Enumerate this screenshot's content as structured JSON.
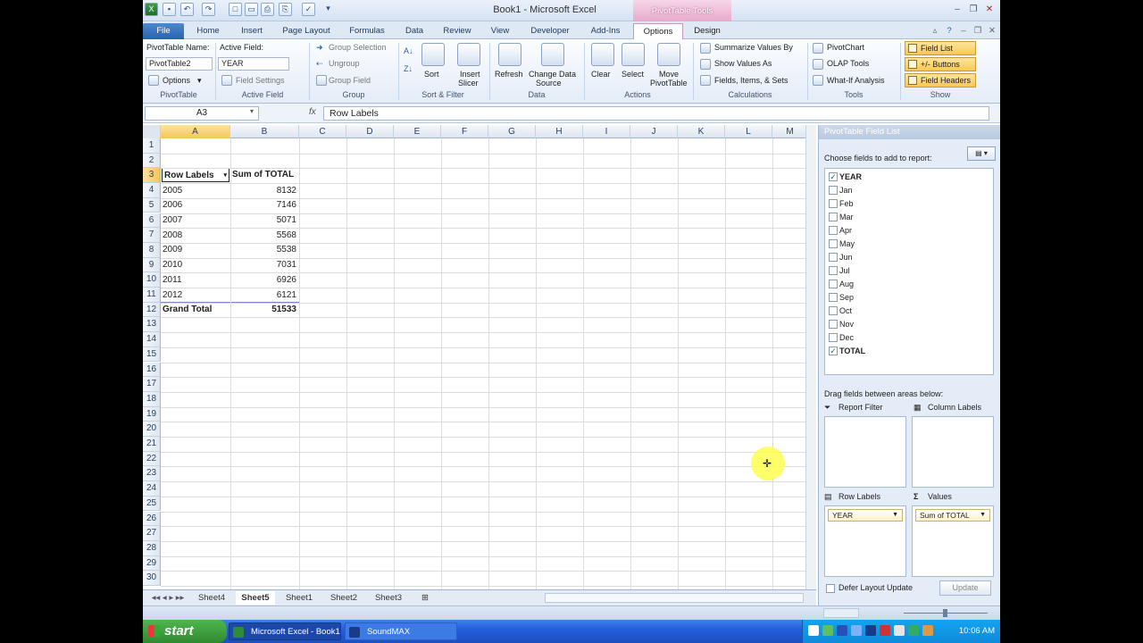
{
  "window": {
    "title": "Book1  -  Microsoft Excel",
    "context_tab_header": "PivotTable Tools"
  },
  "tabs": [
    "File",
    "Home",
    "Insert",
    "Page Layout",
    "Formulas",
    "Data",
    "Review",
    "View",
    "Developer",
    "Add-Ins",
    "Options",
    "Design"
  ],
  "ribbon": {
    "pivottable": {
      "name_label": "PivotTable Name:",
      "name_value": "PivotTable2",
      "options": "Options",
      "group": "PivotTable"
    },
    "active_field": {
      "label": "Active Field:",
      "value": "YEAR",
      "settings": "Field Settings",
      "group": "Active Field"
    },
    "group": {
      "selection": "Group Selection",
      "ungroup": "Ungroup",
      "field": "Group Field",
      "group": "Group"
    },
    "sort": {
      "sort": "Sort",
      "insert_slicer_1": "Insert",
      "insert_slicer_2": "Slicer",
      "group": "Sort & Filter"
    },
    "data": {
      "refresh": "Refresh",
      "change_1": "Change Data",
      "change_2": "Source",
      "group": "Data"
    },
    "actions": {
      "clear": "Clear",
      "select": "Select",
      "move_1": "Move",
      "move_2": "PivotTable",
      "group": "Actions"
    },
    "calculations": {
      "summarize": "Summarize Values By",
      "show_as": "Show Values As",
      "fields": "Fields, Items, & Sets",
      "group": "Calculations"
    },
    "tools": {
      "chart": "PivotChart",
      "olap": "OLAP Tools",
      "whatif": "What-If Analysis",
      "group": "Tools"
    },
    "show": {
      "field_list": "Field List",
      "buttons": "+/- Buttons",
      "headers": "Field Headers",
      "group": "Show"
    }
  },
  "formula_bar": {
    "name_box": "A3",
    "fx": "fx",
    "formula": "Row Labels"
  },
  "columns": [
    "A",
    "B",
    "C",
    "D",
    "E",
    "F",
    "G",
    "H",
    "I",
    "J",
    "K",
    "L",
    "M"
  ],
  "rows": [
    "1",
    "2",
    "3",
    "4",
    "5",
    "6",
    "7",
    "8",
    "9",
    "10",
    "11",
    "12",
    "13",
    "14",
    "15",
    "16",
    "17",
    "18",
    "19",
    "20",
    "21",
    "22",
    "23",
    "24",
    "25",
    "26",
    "27",
    "28",
    "29",
    "30"
  ],
  "pivot": {
    "header_a": "Row Labels",
    "header_b": "Sum of TOTAL",
    "rows": [
      {
        "label": "2005",
        "value": "8132"
      },
      {
        "label": "2006",
        "value": "7146"
      },
      {
        "label": "2007",
        "value": "5071"
      },
      {
        "label": "2008",
        "value": "5568"
      },
      {
        "label": "2009",
        "value": "5538"
      },
      {
        "label": "2010",
        "value": "7031"
      },
      {
        "label": "2011",
        "value": "6926"
      },
      {
        "label": "2012",
        "value": "6121"
      }
    ],
    "total_label": "Grand Total",
    "total_value": "51533"
  },
  "sheets": [
    "Sheet4",
    "Sheet5",
    "Sheet1",
    "Sheet2",
    "Sheet3"
  ],
  "field_list": {
    "title": "PivotTable Field List",
    "choose": "Choose fields to add to report:",
    "fields": [
      {
        "name": "YEAR",
        "checked": "✓"
      },
      {
        "name": "Jan",
        "checked": ""
      },
      {
        "name": "Feb",
        "checked": ""
      },
      {
        "name": "Mar",
        "checked": ""
      },
      {
        "name": "Apr",
        "checked": ""
      },
      {
        "name": "May",
        "checked": ""
      },
      {
        "name": "Jun",
        "checked": ""
      },
      {
        "name": "Jul",
        "checked": ""
      },
      {
        "name": "Aug",
        "checked": ""
      },
      {
        "name": "Sep",
        "checked": ""
      },
      {
        "name": "Oct",
        "checked": ""
      },
      {
        "name": "Nov",
        "checked": ""
      },
      {
        "name": "Dec",
        "checked": ""
      },
      {
        "name": "TOTAL",
        "checked": "✓"
      }
    ],
    "drag": "Drag fields between areas below:",
    "report_filter": "Report Filter",
    "column_labels": "Column Labels",
    "row_labels": "Row Labels",
    "values": "Values",
    "row_field": "YEAR",
    "value_field": "Sum of TOTAL",
    "defer": "Defer Layout Update",
    "update": "Update"
  },
  "taskbar": {
    "start": "start",
    "excel": "Microsoft Excel - Book1",
    "soundmax": "SoundMAX",
    "clock": "10:06 AM"
  }
}
